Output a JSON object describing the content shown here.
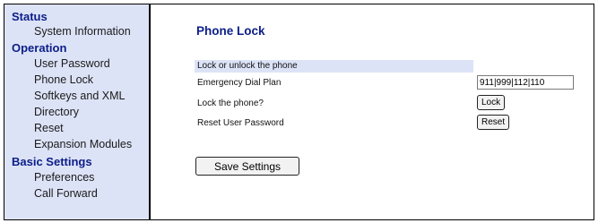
{
  "sidebar": {
    "sections": [
      {
        "heading": "Status",
        "items": [
          "System Information"
        ]
      },
      {
        "heading": "Operation",
        "items": [
          "User Password",
          "Phone Lock",
          "Softkeys and XML",
          "Directory",
          "Reset",
          "Expansion Modules"
        ]
      },
      {
        "heading": "Basic Settings",
        "items": [
          "Preferences",
          "Call Forward"
        ]
      }
    ]
  },
  "main": {
    "title": "Phone Lock",
    "section_label": "Lock or unlock the phone",
    "rows": {
      "dial_plan_label": "Emergency Dial Plan",
      "dial_plan_value": "911|999|112|110",
      "lock_label": "Lock the phone?",
      "lock_button": "Lock",
      "reset_label": "Reset User Password",
      "reset_button": "Reset"
    },
    "save_button": "Save Settings"
  }
}
